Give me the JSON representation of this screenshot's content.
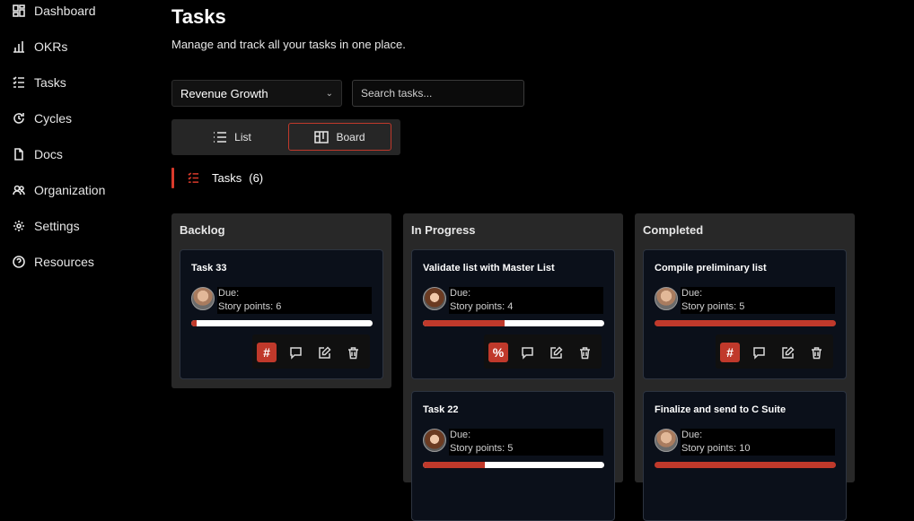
{
  "sidebar": {
    "items": [
      {
        "label": "Dashboard",
        "icon": "dashboard-icon"
      },
      {
        "label": "OKRs",
        "icon": "chart-icon"
      },
      {
        "label": "Tasks",
        "icon": "tasks-icon"
      },
      {
        "label": "Cycles",
        "icon": "cycles-icon"
      },
      {
        "label": "Docs",
        "icon": "document-icon"
      },
      {
        "label": "Organization",
        "icon": "users-icon"
      },
      {
        "label": "Settings",
        "icon": "gear-icon"
      },
      {
        "label": "Resources",
        "icon": "help-icon"
      }
    ]
  },
  "header": {
    "title": "Tasks",
    "subtitle": "Manage and track all your tasks in one place."
  },
  "filters": {
    "objective_selected": "Revenue Growth",
    "search_placeholder": "Search tasks..."
  },
  "view_toggle": {
    "list_label": "List",
    "board_label": "Board",
    "active": "Board"
  },
  "section": {
    "label": "Tasks",
    "count": "(6)"
  },
  "colors": {
    "accent": "#d93a2b",
    "progress_fill": "#c0392b",
    "card_bg": "#0b101a",
    "column_bg": "#282828"
  },
  "columns": [
    {
      "title": "Backlog",
      "cards": [
        {
          "title": "Task 33",
          "due": "Due:",
          "story_points": "Story points: 6",
          "progress": 0.03,
          "action_icon": "#"
        }
      ]
    },
    {
      "title": "In Progress",
      "cards": [
        {
          "title": "Validate list with Master List",
          "due": "Due:",
          "story_points": "Story points: 4",
          "progress": 0.45,
          "action_icon": "%"
        },
        {
          "title": "Task 22",
          "due": "Due:",
          "story_points": "Story points: 5",
          "progress": 0.34
        }
      ]
    },
    {
      "title": "Completed",
      "cards": [
        {
          "title": "Compile preliminary list",
          "due": "Due:",
          "story_points": "Story points: 5",
          "progress": 1.0,
          "action_icon": "#"
        },
        {
          "title": "Finalize and send to C Suite",
          "due": "Due:",
          "story_points": "Story points: 10",
          "progress": 1.0
        }
      ]
    }
  ]
}
